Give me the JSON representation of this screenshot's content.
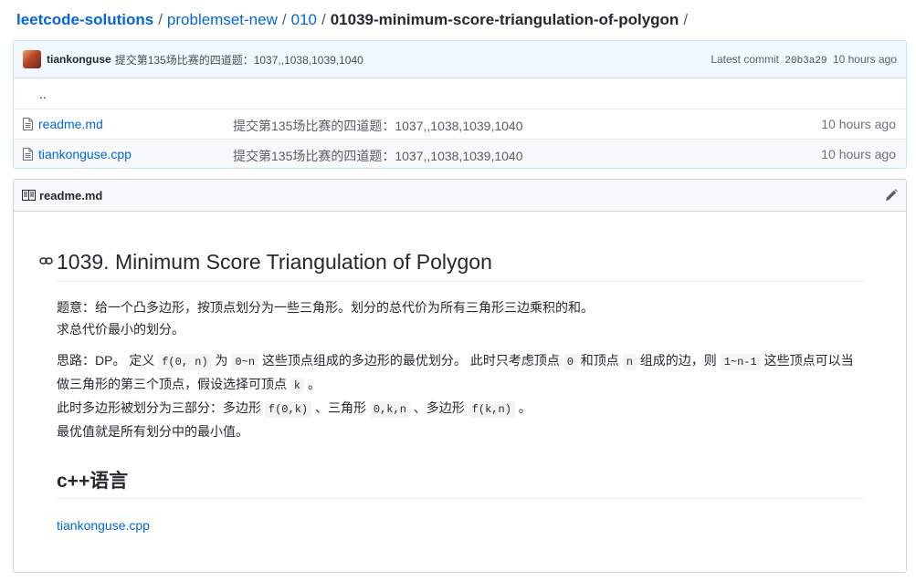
{
  "breadcrumb": {
    "repo": "leetcode-solutions",
    "seg1": "problemset-new",
    "seg2": "010",
    "current": "01039-minimum-score-triangulation-of-polygon",
    "sep": "/"
  },
  "commit": {
    "author": "tiankonguse",
    "message": "提交第135场比赛的四道题：1037,,1038,1039,1040",
    "latest_label": "Latest commit",
    "sha": "20b3a29",
    "age": "10 hours ago"
  },
  "files": {
    "parent": "..",
    "items": [
      {
        "name": "readme.md",
        "message": "提交第135场比赛的四道题：1037,,1038,1039,1040",
        "age": "10 hours ago"
      },
      {
        "name": "tiankonguse.cpp",
        "message": "提交第135场比赛的四道题：1037,,1038,1039,1040",
        "age": "10 hours ago"
      }
    ]
  },
  "readme": {
    "file_title": "readme.md",
    "h1": "1039. Minimum Score Triangulation of Polygon",
    "para1": {
      "line1": "题意：给一个凸多边形，按顶点划分为一些三角形。划分的总代价为所有三角形三边乘积的和。",
      "line2": "求总代价最小的划分。"
    },
    "para2": {
      "t1": "思路：DP。 定义 ",
      "c1": "f(0, n)",
      "t2": " 为 ",
      "c2": "0~n",
      "t3": " 这些顶点组成的多边形的最优划分。 此时只考虑顶点 ",
      "c3": "0",
      "t4": " 和顶点 ",
      "c4": "n",
      "t5": " 组成的边，则 ",
      "c5": "1~n-1",
      "t6": " 这些顶点可以当做三角形的第三个顶点，假设选择可顶点 ",
      "c6": "k",
      "t7": " 。",
      "t8": "此时多边形被划分为三部分：多边形 ",
      "c7": "f(0,k)",
      "t9": " 、三角形 ",
      "c8": "0,k,n",
      "t10": " 、多边形 ",
      "c9": "f(k,n)",
      "t11": " 。",
      "t12": "最优值就是所有划分中的最小值。"
    },
    "h2": "c++语言",
    "link": "tiankonguse.cpp"
  },
  "icons": {
    "file": "file-icon",
    "book": "book-icon",
    "pencil": "pencil-icon",
    "anchor": "link-icon"
  }
}
